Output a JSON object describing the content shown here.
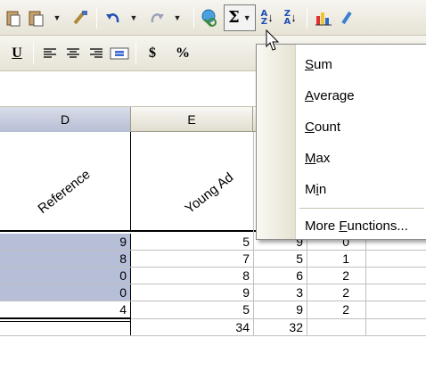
{
  "toolbar1": {
    "items": [
      "paste-icon",
      "dropdown-arrow",
      "format-painter-icon",
      "undo-icon",
      "dropdown-arrow",
      "redo-icon",
      "dropdown-arrow",
      "hyperlink-icon",
      "autosum-icon",
      "sort-ascending-icon",
      "sort-descending-icon",
      "chart-wizard-icon",
      "drawing-icon"
    ],
    "autosum_symbol": "Σ",
    "sort_asc_label": "A\nZ",
    "sort_desc_label": "Z\nA"
  },
  "toolbar2": {
    "underline_label": "U",
    "currency_label": "$",
    "percent_label": "%"
  },
  "columns": [
    {
      "label": "D",
      "selected": true
    },
    {
      "label": "E",
      "selected": false
    }
  ],
  "headers": {
    "reference": "Reference",
    "young": "Young Ad"
  },
  "rows": [
    {
      "d": "9",
      "e": "5",
      "f": "9",
      "g": "0"
    },
    {
      "d": "8",
      "e": "7",
      "f": "5",
      "g": "1"
    },
    {
      "d": "0",
      "e": "8",
      "f": "6",
      "g": "2"
    },
    {
      "d": "0",
      "e": "9",
      "f": "3",
      "g": "2"
    },
    {
      "d": "4",
      "e": "5",
      "f": "9",
      "g": "2"
    }
  ],
  "totals": {
    "e": "34",
    "f": "32"
  },
  "menu": {
    "items": [
      {
        "pre": "",
        "ul": "S",
        "post": "um"
      },
      {
        "pre": "",
        "ul": "A",
        "post": "verage"
      },
      {
        "pre": "",
        "ul": "C",
        "post": "ount"
      },
      {
        "pre": "",
        "ul": "M",
        "post": "ax"
      },
      {
        "pre": "M",
        "ul": "i",
        "post": "n"
      },
      {
        "pre": "More ",
        "ul": "F",
        "post": "unctions..."
      }
    ]
  },
  "colors": {
    "selection": "#b6bed8",
    "toolbar": "#ece9d8"
  }
}
